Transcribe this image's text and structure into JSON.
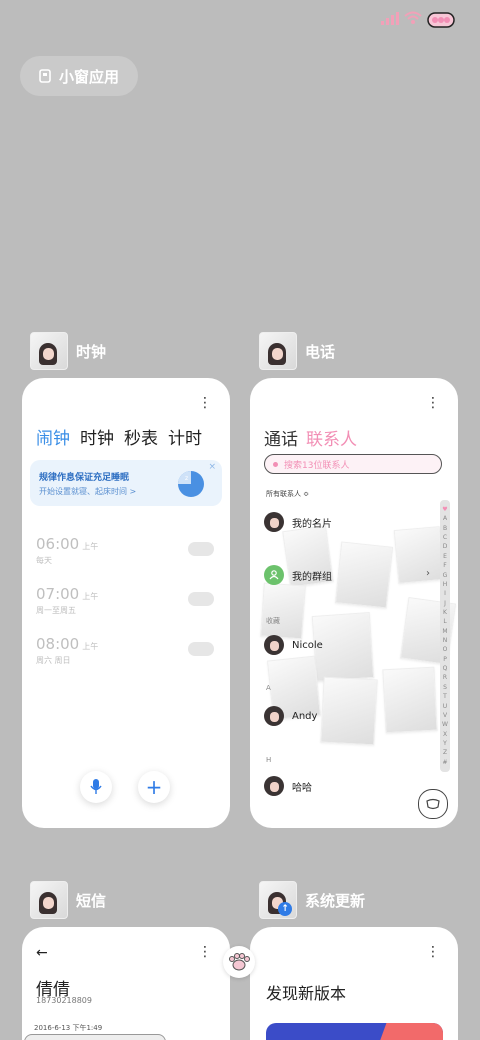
{
  "float_window": {
    "label": "小窗应用"
  },
  "cards": {
    "clock": {
      "title": "时钟",
      "tabs": [
        "闹钟",
        "时钟",
        "秒表",
        "计时"
      ],
      "banner": {
        "title": "规律作息保证充足睡眠",
        "subtitle": "开始设置就寝、起床时间 >"
      },
      "alarms": [
        {
          "time": "06:00",
          "ampm": "上午",
          "days": "每天"
        },
        {
          "time": "07:00",
          "ampm": "上午",
          "days": "周一至周五"
        },
        {
          "time": "08:00",
          "ampm": "上午",
          "days": "周六 周日"
        }
      ]
    },
    "phone": {
      "title": "电话",
      "tabs": [
        "通话",
        "联系人"
      ],
      "search_placeholder": "搜索13位联系人",
      "filter": "所有联系人 ≎",
      "rows": {
        "my_card": "我的名片",
        "my_groups": "我的群组",
        "section_fav": "收藏",
        "nicole": "Nicole",
        "section_a": "A",
        "andy": "Andy",
        "section_h": "H",
        "haha": "哈哈"
      },
      "index_letters": [
        "♥",
        "A",
        "B",
        "C",
        "D",
        "E",
        "F",
        "G",
        "H",
        "I",
        "J",
        "K",
        "L",
        "M",
        "N",
        "O",
        "P",
        "Q",
        "R",
        "S",
        "T",
        "U",
        "V",
        "W",
        "X",
        "Y",
        "Z",
        "#"
      ]
    },
    "sms": {
      "title": "短信",
      "contact_name": "倩倩",
      "contact_number": "18730218809",
      "date": "2016-6-13 下午1:49"
    },
    "update": {
      "title": "系统更新",
      "heading": "发现新版本"
    }
  },
  "colors": {
    "accent_blue": "#3a8ee6",
    "pink": "#f28fb5",
    "background": "#bcbcbc"
  }
}
